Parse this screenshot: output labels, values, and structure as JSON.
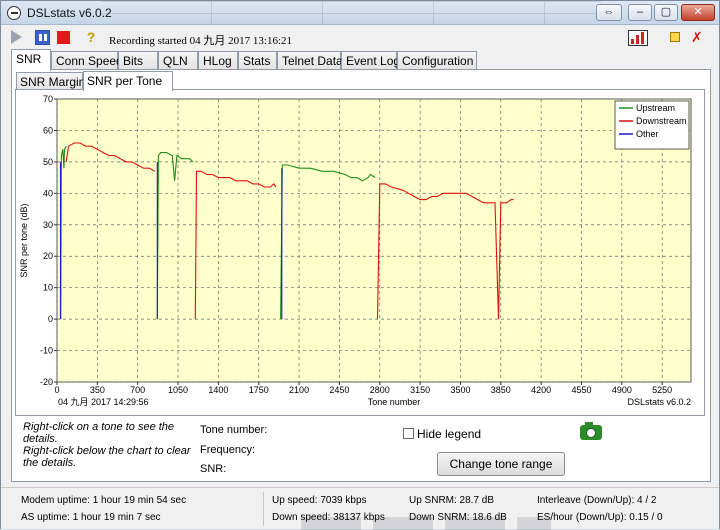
{
  "window": {
    "title": "DSLstats v6.0.2",
    "controls": [
      "⇔",
      "–",
      "▢",
      "✕"
    ]
  },
  "toolbar": {
    "recording_text": "Recording started 04 九月 2017 13:16:21",
    "help_glyph": "?",
    "close_glyph": "✗"
  },
  "tabs": [
    "SNR",
    "Conn Speed",
    "Bits",
    "QLN",
    "HLog",
    "Stats",
    "Telnet Data",
    "Event Log",
    "Configuration"
  ],
  "active_tab": "SNR",
  "subtabs": [
    "SNR Margin",
    "SNR per Tone"
  ],
  "active_subtab": "SNR per Tone",
  "chart_data": {
    "type": "line",
    "ylabel": "SNR per tone (dB)",
    "xlabel": "Tone number",
    "timestamp": "04 九月 2017 14:29:56",
    "watermark": "DSLstats v6.0.2",
    "ylim": [
      -20,
      70
    ],
    "yticks": [
      -20,
      -10,
      0,
      10,
      20,
      30,
      40,
      50,
      60,
      70
    ],
    "xlim": [
      0,
      5500
    ],
    "xticks": [
      0,
      350,
      700,
      1050,
      1400,
      1750,
      2100,
      2450,
      2800,
      3150,
      3500,
      3850,
      4200,
      4550,
      4900,
      5250
    ],
    "grid": true,
    "legend_position": "top-right",
    "colors": {
      "Upstream": "#1e8c1e",
      "Downstream": "#e01010",
      "Other": "#1a1acc"
    },
    "series": [
      {
        "name": "Upstream",
        "points": [
          [
            32,
            0
          ],
          [
            38,
            52
          ],
          [
            50,
            54
          ],
          [
            60,
            48
          ],
          [
            65,
            54
          ],
          [
            80,
            55
          ]
        ]
      },
      {
        "name": "Downstream",
        "points": [
          [
            80,
            50
          ],
          [
            100,
            55
          ],
          [
            150,
            56
          ],
          [
            200,
            56
          ],
          [
            250,
            55
          ],
          [
            300,
            55
          ],
          [
            350,
            54
          ],
          [
            400,
            53
          ],
          [
            450,
            52
          ],
          [
            500,
            52
          ],
          [
            550,
            51
          ],
          [
            600,
            50
          ],
          [
            650,
            50
          ],
          [
            700,
            49
          ],
          [
            750,
            48
          ],
          [
            800,
            48
          ],
          [
            850,
            47
          ]
        ]
      },
      {
        "name": "Upstream",
        "points": [
          [
            870,
            0
          ],
          [
            880,
            52
          ],
          [
            900,
            53
          ],
          [
            950,
            53
          ],
          [
            1000,
            52
          ],
          [
            1020,
            44
          ],
          [
            1040,
            52
          ],
          [
            1080,
            51
          ],
          [
            1150,
            51
          ],
          [
            1180,
            50
          ]
        ]
      },
      {
        "name": "Downstream",
        "points": [
          [
            1200,
            0
          ],
          [
            1210,
            47
          ],
          [
            1250,
            47
          ],
          [
            1300,
            46
          ],
          [
            1350,
            46
          ],
          [
            1400,
            45
          ],
          [
            1450,
            45
          ],
          [
            1500,
            45
          ],
          [
            1550,
            44
          ],
          [
            1600,
            44
          ],
          [
            1650,
            44
          ],
          [
            1700,
            43
          ],
          [
            1750,
            43
          ],
          [
            1800,
            42
          ],
          [
            1850,
            42
          ],
          [
            1880,
            43
          ],
          [
            1900,
            42
          ]
        ]
      },
      {
        "name": "Upstream",
        "points": [
          [
            1940,
            0
          ],
          [
            1955,
            49
          ],
          [
            2000,
            49
          ],
          [
            2100,
            48
          ],
          [
            2200,
            48
          ],
          [
            2300,
            47
          ],
          [
            2400,
            47
          ],
          [
            2500,
            46
          ],
          [
            2550,
            45
          ],
          [
            2600,
            45
          ],
          [
            2650,
            44
          ],
          [
            2700,
            45
          ],
          [
            2720,
            46
          ],
          [
            2760,
            45
          ]
        ]
      },
      {
        "name": "Downstream",
        "points": [
          [
            2780,
            0
          ],
          [
            2800,
            43
          ],
          [
            2850,
            43
          ],
          [
            2900,
            42
          ],
          [
            3000,
            41
          ],
          [
            3050,
            40
          ],
          [
            3100,
            39
          ],
          [
            3150,
            38
          ],
          [
            3200,
            38
          ],
          [
            3250,
            39
          ],
          [
            3300,
            39
          ],
          [
            3350,
            40
          ],
          [
            3400,
            40
          ],
          [
            3450,
            40
          ],
          [
            3500,
            40
          ],
          [
            3550,
            40
          ],
          [
            3600,
            39
          ],
          [
            3650,
            38
          ],
          [
            3700,
            37
          ],
          [
            3750,
            37
          ],
          [
            3800,
            37
          ],
          [
            3830,
            0
          ],
          [
            3850,
            37
          ],
          [
            3900,
            37
          ],
          [
            3940,
            38
          ],
          [
            3960,
            38
          ]
        ]
      },
      {
        "name": "Other",
        "points": [
          [
            30,
            0
          ],
          [
            30,
            50
          ]
        ]
      },
      {
        "name": "Other",
        "points": [
          [
            870,
            0
          ],
          [
            870,
            50
          ]
        ]
      },
      {
        "name": "Other",
        "points": [
          [
            1950,
            0
          ],
          [
            1950,
            48
          ]
        ]
      }
    ]
  },
  "details": {
    "hint_lines": [
      "Right-click on a tone to see the details.",
      "Right-click below the chart to clear the details."
    ],
    "tone_label": "Tone number:",
    "freq_label": "Frequency:",
    "snr_label": "SNR:",
    "hide_legend_label": "Hide legend",
    "range_button": "Change tone range"
  },
  "status": {
    "modem_uptime": "Modem uptime:  1 hour 19 min 54 sec",
    "as_uptime": "AS uptime:  1 hour 19 min 7 sec",
    "up_speed": "Up speed: 7039 kbps",
    "down_speed": "Down speed: 38137 kbps",
    "up_snrm": "Up SNRM: 28.7 dB",
    "down_snrm": "Down SNRM: 18.6 dB",
    "interleave": "Interleave (Down/Up): 4 / 2",
    "es_hour": "ES/hour (Down/Up): 0.15 / 0"
  }
}
